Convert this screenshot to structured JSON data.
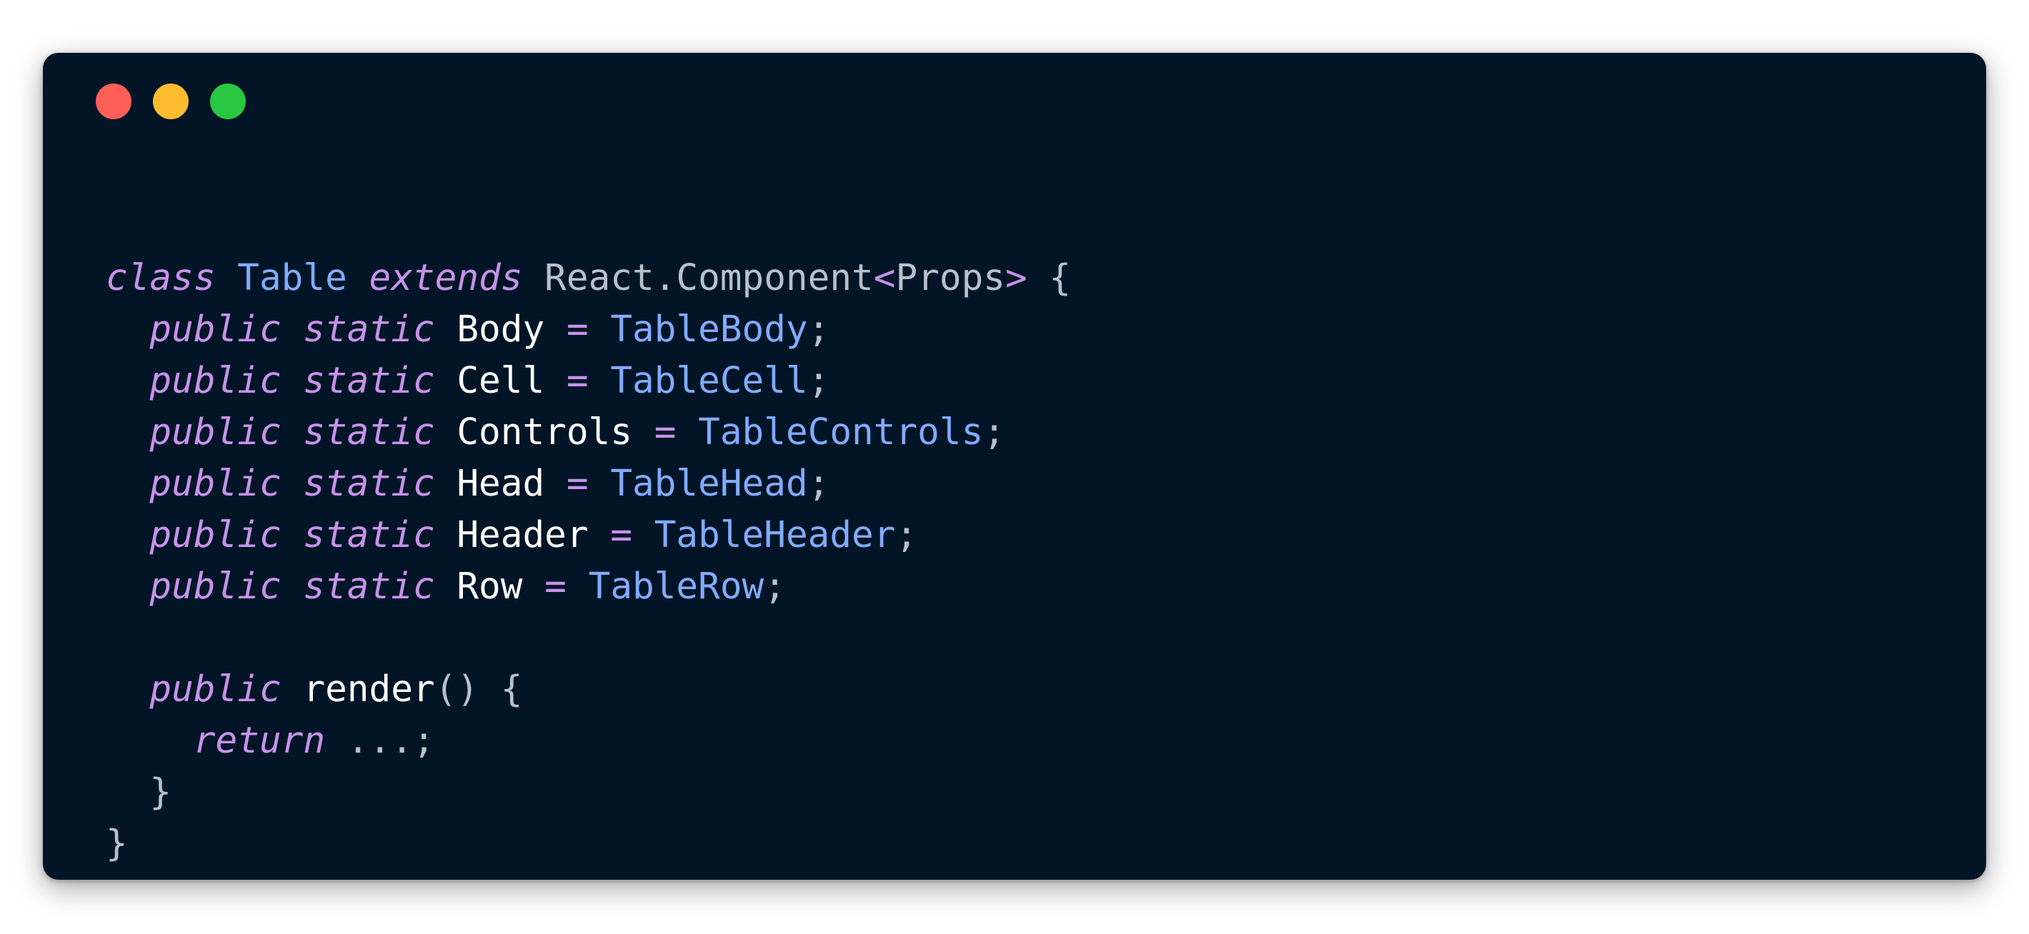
{
  "colors": {
    "background": "#021526",
    "keyword": "#c792ea",
    "type": "#82aaff",
    "identifier": "#ffffff",
    "operator": "#c792ea",
    "punctuation": "#b7c0cc",
    "plain": "#b7c0cc"
  },
  "window_controls": [
    "close",
    "minimize",
    "maximize"
  ],
  "code_lines": [
    [
      {
        "t": "class",
        "c": "keyword",
        "i": true
      },
      {
        "t": " ",
        "c": "plain"
      },
      {
        "t": "Table",
        "c": "type"
      },
      {
        "t": " ",
        "c": "plain"
      },
      {
        "t": "extends",
        "c": "keyword",
        "i": true
      },
      {
        "t": " ",
        "c": "plain"
      },
      {
        "t": "React.Component",
        "c": "plain"
      },
      {
        "t": "<",
        "c": "operator"
      },
      {
        "t": "Props",
        "c": "plain"
      },
      {
        "t": ">",
        "c": "operator"
      },
      {
        "t": " {",
        "c": "punctuation"
      }
    ],
    [
      {
        "t": "  ",
        "c": "plain"
      },
      {
        "t": "public",
        "c": "keyword",
        "i": true
      },
      {
        "t": " ",
        "c": "plain"
      },
      {
        "t": "static",
        "c": "keyword",
        "i": true
      },
      {
        "t": " ",
        "c": "plain"
      },
      {
        "t": "Body",
        "c": "identifier"
      },
      {
        "t": " ",
        "c": "plain"
      },
      {
        "t": "=",
        "c": "operator"
      },
      {
        "t": " ",
        "c": "plain"
      },
      {
        "t": "TableBody",
        "c": "type"
      },
      {
        "t": ";",
        "c": "punctuation"
      }
    ],
    [
      {
        "t": "  ",
        "c": "plain"
      },
      {
        "t": "public",
        "c": "keyword",
        "i": true
      },
      {
        "t": " ",
        "c": "plain"
      },
      {
        "t": "static",
        "c": "keyword",
        "i": true
      },
      {
        "t": " ",
        "c": "plain"
      },
      {
        "t": "Cell",
        "c": "identifier"
      },
      {
        "t": " ",
        "c": "plain"
      },
      {
        "t": "=",
        "c": "operator"
      },
      {
        "t": " ",
        "c": "plain"
      },
      {
        "t": "TableCell",
        "c": "type"
      },
      {
        "t": ";",
        "c": "punctuation"
      }
    ],
    [
      {
        "t": "  ",
        "c": "plain"
      },
      {
        "t": "public",
        "c": "keyword",
        "i": true
      },
      {
        "t": " ",
        "c": "plain"
      },
      {
        "t": "static",
        "c": "keyword",
        "i": true
      },
      {
        "t": " ",
        "c": "plain"
      },
      {
        "t": "Controls",
        "c": "identifier"
      },
      {
        "t": " ",
        "c": "plain"
      },
      {
        "t": "=",
        "c": "operator"
      },
      {
        "t": " ",
        "c": "plain"
      },
      {
        "t": "TableControls",
        "c": "type"
      },
      {
        "t": ";",
        "c": "punctuation"
      }
    ],
    [
      {
        "t": "  ",
        "c": "plain"
      },
      {
        "t": "public",
        "c": "keyword",
        "i": true
      },
      {
        "t": " ",
        "c": "plain"
      },
      {
        "t": "static",
        "c": "keyword",
        "i": true
      },
      {
        "t": " ",
        "c": "plain"
      },
      {
        "t": "Head",
        "c": "identifier"
      },
      {
        "t": " ",
        "c": "plain"
      },
      {
        "t": "=",
        "c": "operator"
      },
      {
        "t": " ",
        "c": "plain"
      },
      {
        "t": "TableHead",
        "c": "type"
      },
      {
        "t": ";",
        "c": "punctuation"
      }
    ],
    [
      {
        "t": "  ",
        "c": "plain"
      },
      {
        "t": "public",
        "c": "keyword",
        "i": true
      },
      {
        "t": " ",
        "c": "plain"
      },
      {
        "t": "static",
        "c": "keyword",
        "i": true
      },
      {
        "t": " ",
        "c": "plain"
      },
      {
        "t": "Header",
        "c": "identifier"
      },
      {
        "t": " ",
        "c": "plain"
      },
      {
        "t": "=",
        "c": "operator"
      },
      {
        "t": " ",
        "c": "plain"
      },
      {
        "t": "TableHeader",
        "c": "type"
      },
      {
        "t": ";",
        "c": "punctuation"
      }
    ],
    [
      {
        "t": "  ",
        "c": "plain"
      },
      {
        "t": "public",
        "c": "keyword",
        "i": true
      },
      {
        "t": " ",
        "c": "plain"
      },
      {
        "t": "static",
        "c": "keyword",
        "i": true
      },
      {
        "t": " ",
        "c": "plain"
      },
      {
        "t": "Row",
        "c": "identifier"
      },
      {
        "t": " ",
        "c": "plain"
      },
      {
        "t": "=",
        "c": "operator"
      },
      {
        "t": " ",
        "c": "plain"
      },
      {
        "t": "TableRow",
        "c": "type"
      },
      {
        "t": ";",
        "c": "punctuation"
      }
    ],
    [],
    [
      {
        "t": "  ",
        "c": "plain"
      },
      {
        "t": "public",
        "c": "keyword",
        "i": true
      },
      {
        "t": " ",
        "c": "plain"
      },
      {
        "t": "render",
        "c": "identifier"
      },
      {
        "t": "()",
        "c": "punctuation"
      },
      {
        "t": " {",
        "c": "punctuation"
      }
    ],
    [
      {
        "t": "    ",
        "c": "plain"
      },
      {
        "t": "return",
        "c": "keyword",
        "i": true
      },
      {
        "t": " ",
        "c": "plain"
      },
      {
        "t": "...;",
        "c": "punctuation"
      }
    ],
    [
      {
        "t": "  ",
        "c": "plain"
      },
      {
        "t": "}",
        "c": "punctuation"
      }
    ],
    [
      {
        "t": "}",
        "c": "punctuation"
      }
    ]
  ]
}
